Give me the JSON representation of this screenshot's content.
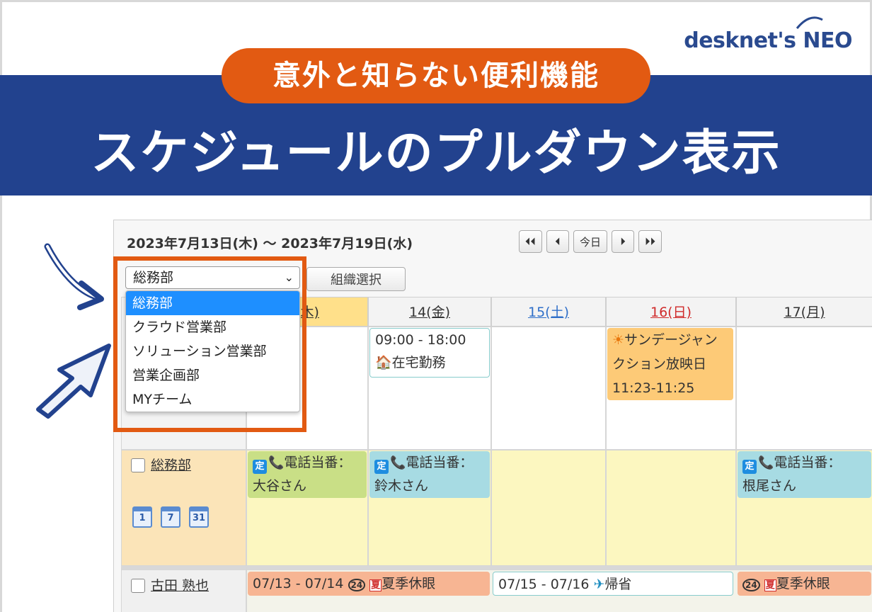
{
  "logo": {
    "text": "desknet's NEO"
  },
  "banner": {
    "pill": "意外と知らない便利機能",
    "title": "スケジュールのプルダウン表示"
  },
  "calendar": {
    "range": "2023年7月13日(木) ～ 2023年7月19日(水)",
    "nav": {
      "first": "⏴⏴",
      "prev": "⏴",
      "today": "今日",
      "next": "⏵",
      "last": "⏵⏵"
    },
    "org_select_button": "組織選択",
    "columns": [
      {
        "label": "(木)",
        "color": "#333333"
      },
      {
        "label": "14(金)",
        "color": "#333333"
      },
      {
        "label": "15(土)",
        "color": "#2f6fc9"
      },
      {
        "label": "16(日)",
        "color": "#d02c2c"
      },
      {
        "label": "17(月)",
        "color": "#333333"
      }
    ],
    "row1_events": {
      "fri_time": "09:00 - 18:00",
      "fri_title": "在宅勤務",
      "sun_line1": "サンデージャン",
      "sun_line2": "クション放映日",
      "sun_time": "11:23-11:25"
    },
    "group_row": {
      "name": "総務部",
      "cal_icons": [
        "1",
        "7",
        "31"
      ],
      "events": [
        {
          "tag": "定",
          "line1": "電話当番：",
          "line2": "大谷さん"
        },
        {
          "tag": "定",
          "line1": "電話当番：",
          "line2": "鈴木さん"
        },
        {
          "tag": "定",
          "line1": "電話当番：",
          "line2": "根尾さん"
        }
      ]
    },
    "person_row": {
      "name": "古田 熟也",
      "ev1": "07/13 - 07/14",
      "ev1_badge": "24",
      "ev1_title": "夏季休眼",
      "ev2": "07/15 - 07/16",
      "ev2_title": "帰省",
      "ev3_badge": "24",
      "ev3_title": "夏季休眼"
    }
  },
  "dropdown": {
    "selected": "総務部",
    "options": [
      "総務部",
      "クラウド営業部",
      "ソリューション営業部",
      "営業企画部",
      "MYチーム"
    ]
  }
}
